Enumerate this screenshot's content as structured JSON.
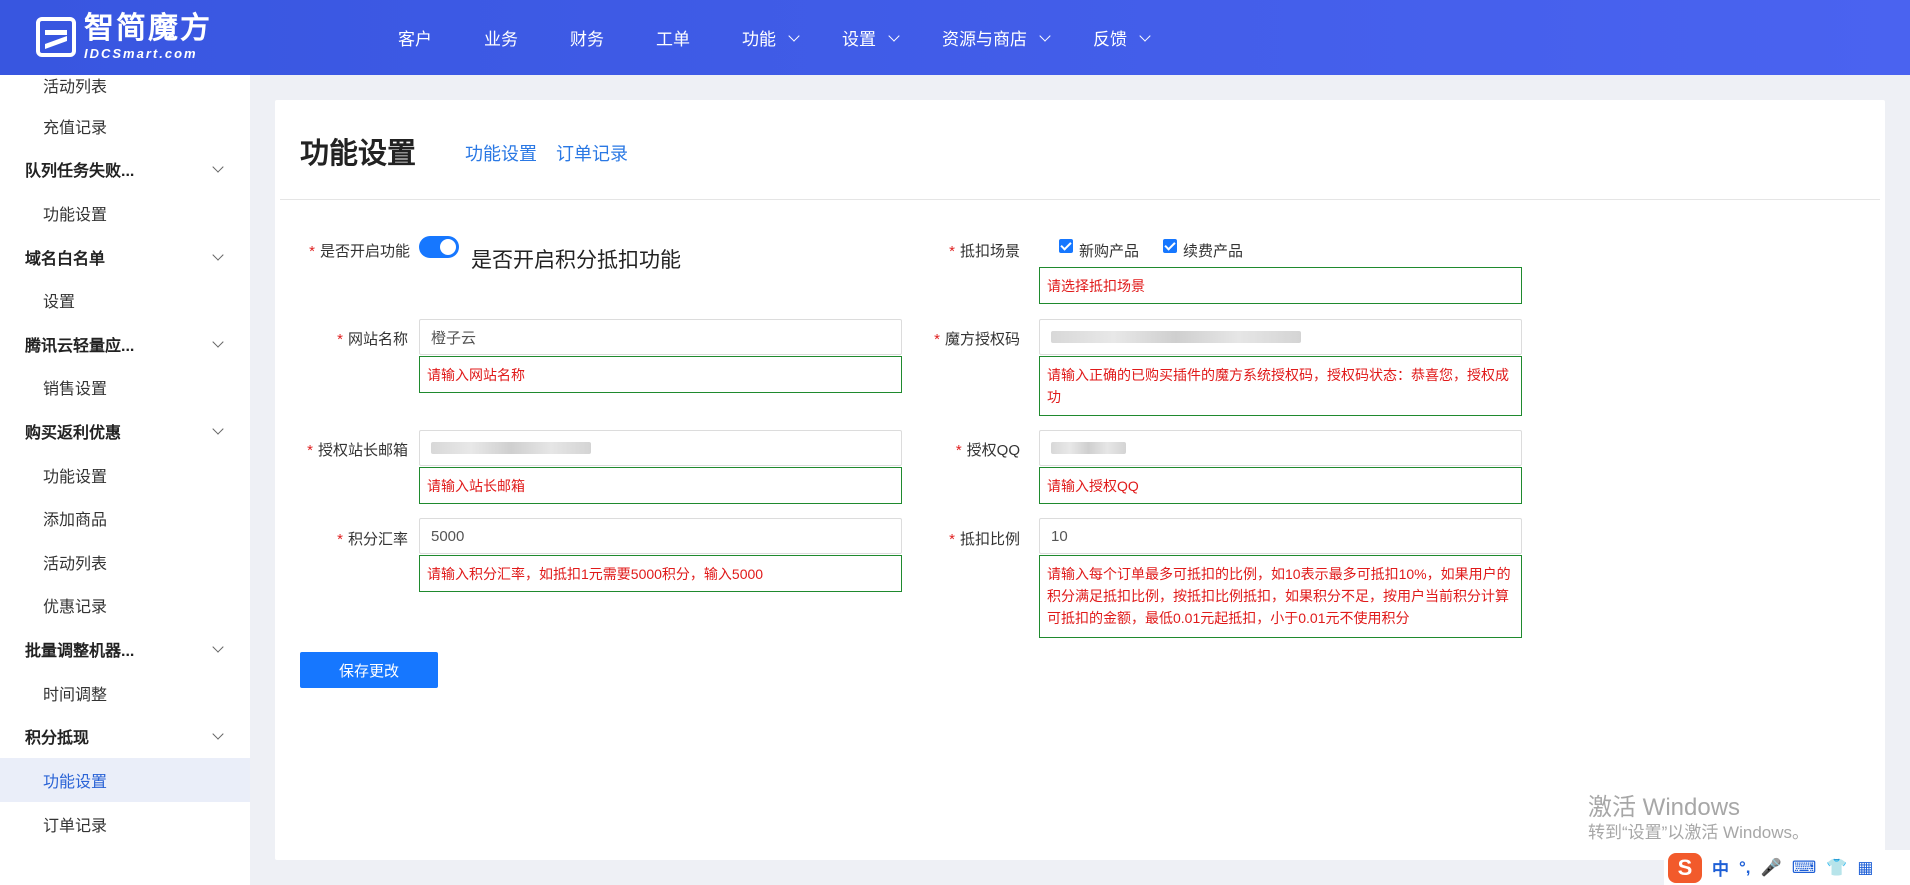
{
  "brand": {
    "name_cn": "智简魔方",
    "name_en": "IDCSmart.com"
  },
  "nav": {
    "items": [
      {
        "label": "客户",
        "has_dropdown": false
      },
      {
        "label": "业务",
        "has_dropdown": false
      },
      {
        "label": "财务",
        "has_dropdown": false
      },
      {
        "label": "工单",
        "has_dropdown": false
      },
      {
        "label": "功能",
        "has_dropdown": true
      },
      {
        "label": "设置",
        "has_dropdown": true
      },
      {
        "label": "资源与商店",
        "has_dropdown": true
      },
      {
        "label": "反馈",
        "has_dropdown": true
      }
    ]
  },
  "sidebar": {
    "items": [
      {
        "label": "活动列表",
        "type": "sub"
      },
      {
        "label": "充值记录",
        "type": "sub"
      },
      {
        "label": "队列任务失败...",
        "type": "group"
      },
      {
        "label": "功能设置",
        "type": "sub"
      },
      {
        "label": "域名白名单",
        "type": "group"
      },
      {
        "label": "设置",
        "type": "sub"
      },
      {
        "label": "腾讯云轻量应...",
        "type": "group"
      },
      {
        "label": "销售设置",
        "type": "sub"
      },
      {
        "label": "购买返利优惠",
        "type": "group"
      },
      {
        "label": "功能设置",
        "type": "sub"
      },
      {
        "label": "添加商品",
        "type": "sub"
      },
      {
        "label": "活动列表",
        "type": "sub"
      },
      {
        "label": "优惠记录",
        "type": "sub"
      },
      {
        "label": "批量调整机器...",
        "type": "group"
      },
      {
        "label": "时间调整",
        "type": "sub"
      },
      {
        "label": "积分抵现",
        "type": "group"
      },
      {
        "label": "功能设置",
        "type": "sub",
        "active": true
      },
      {
        "label": "订单记录",
        "type": "sub"
      }
    ]
  },
  "page": {
    "title": "功能设置",
    "tabs": [
      {
        "label": "功能设置"
      },
      {
        "label": "订单记录"
      }
    ]
  },
  "form": {
    "enable": {
      "label": "是否开启功能",
      "toggle_on": true,
      "toggle_text": "是否开启积分抵扣功能"
    },
    "scene": {
      "label": "抵扣场景",
      "options": [
        {
          "label": "新购产品",
          "checked": true
        },
        {
          "label": "续费产品",
          "checked": true
        }
      ],
      "hint": "请选择抵扣场景"
    },
    "site_name": {
      "label": "网站名称",
      "value": "橙子云",
      "hint": "请输入网站名称"
    },
    "auth_code": {
      "label": "魔方授权码",
      "value": "",
      "hint": "请输入正确的已购买插件的魔方系统授权码，授权码状态：恭喜您，授权成功"
    },
    "email": {
      "label": "授权站长邮箱",
      "value": "",
      "hint": "请输入站长邮箱"
    },
    "qq": {
      "label": "授权QQ",
      "value": "",
      "hint": "请输入授权QQ"
    },
    "rate": {
      "label": "积分汇率",
      "value": "5000",
      "hint": "请输入积分汇率，如抵扣1元需要5000积分，输入5000"
    },
    "ratio": {
      "label": "抵扣比例",
      "value": "10",
      "hint": "请输入每个订单最多可抵扣的比例，如10表示最多可抵扣10%，如果用户的积分满足抵扣比例，按抵扣比例抵扣，如果积分不足，按用户当前积分计算可抵扣的金额，最低0.01元起抵扣，小于0.01元不使用积分"
    },
    "save_label": "保存更改"
  },
  "watermark": {
    "line1": "激活 Windows",
    "line2": "转到“设置”以激活 Windows。"
  },
  "ime": {
    "logo": "S",
    "mode": "中",
    "punct": "°,"
  }
}
